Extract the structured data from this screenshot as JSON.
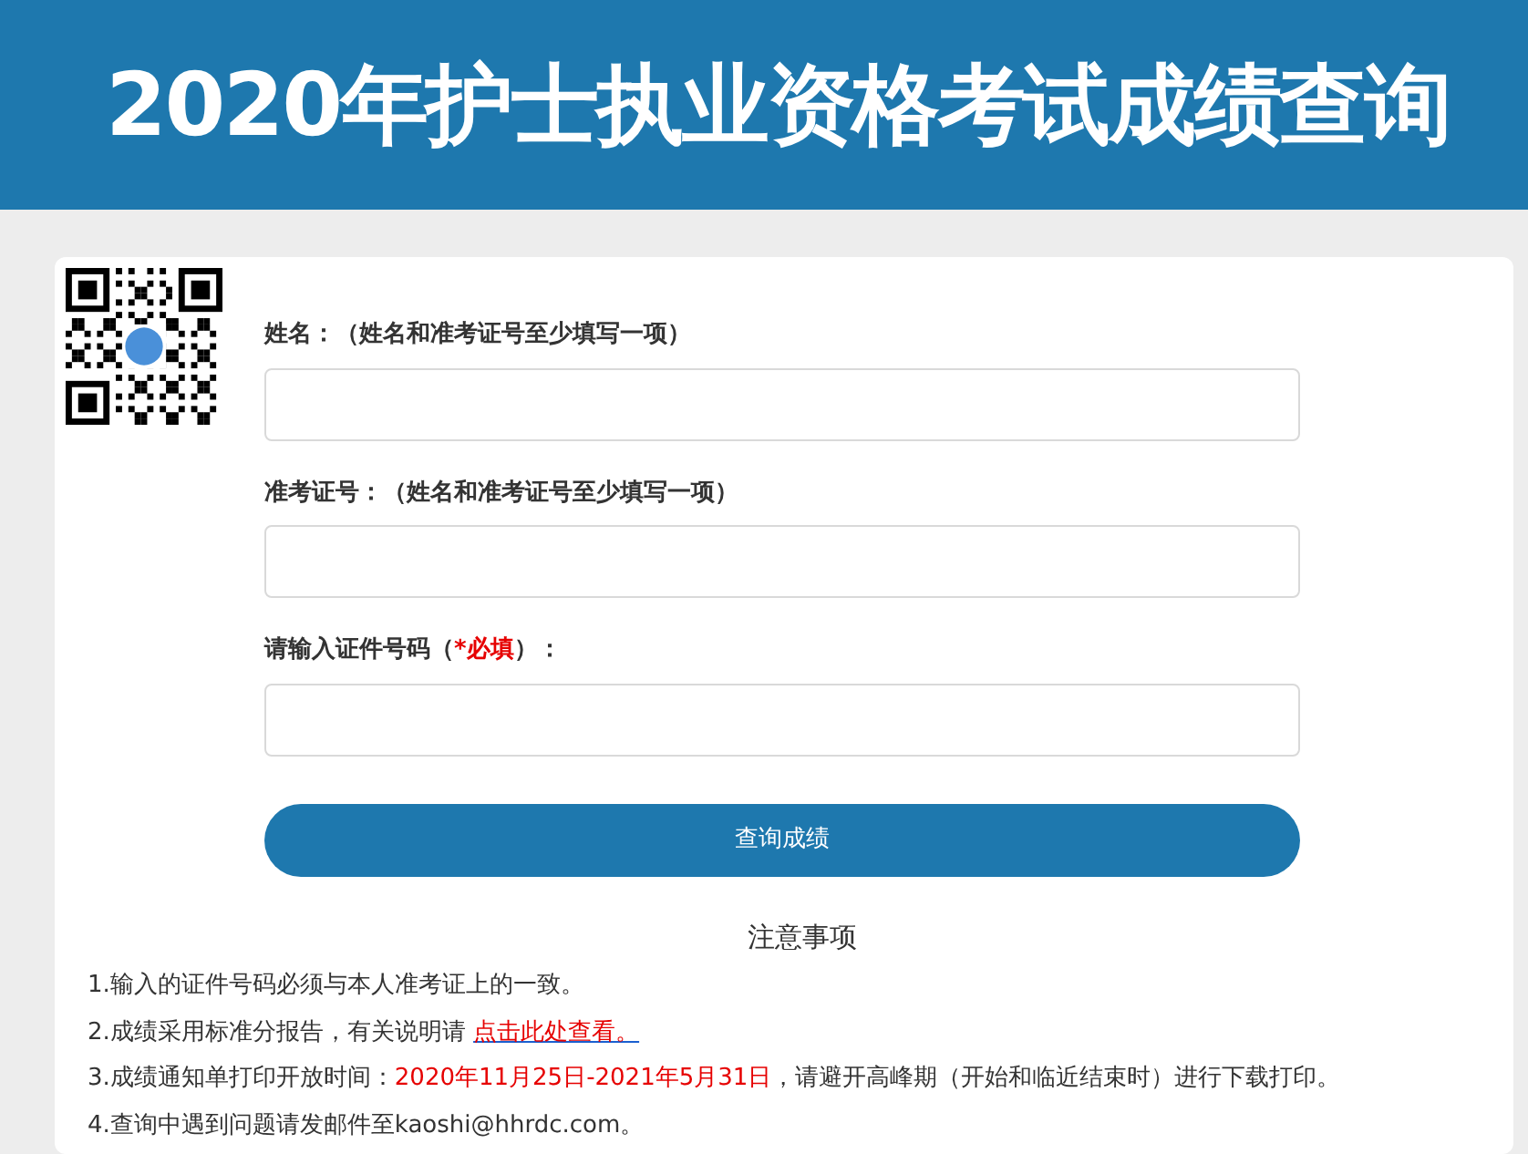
{
  "header": {
    "title": "2020年护士执业资格考试成绩查询"
  },
  "form": {
    "fields": [
      {
        "label": [
          {
            "kind": "plain",
            "text": "姓名：（姓名和准考证号至少填写一项）"
          }
        ]
      },
      {
        "label": [
          {
            "kind": "plain",
            "text": "准考证号：（姓名和准考证号至少填写一项）"
          }
        ]
      },
      {
        "label": [
          {
            "kind": "plain",
            "text": "请输入证件号码（"
          },
          {
            "kind": "required",
            "text": "*必填"
          },
          {
            "kind": "plain",
            "text": "）："
          }
        ]
      }
    ],
    "submit": "查询成绩"
  },
  "notes": {
    "title": "注意事项",
    "items": [
      [
        {
          "kind": "plain",
          "text": "1.输入的证件号码必须与本人准考证上的一致。"
        }
      ],
      [
        {
          "kind": "plain",
          "text": "2.成绩采用标准分报告，有关说明请 "
        },
        {
          "kind": "link",
          "text": "点击此处查看。"
        }
      ],
      [
        {
          "kind": "plain",
          "text": "3.成绩通知单打印开放时间："
        },
        {
          "kind": "highlight",
          "text": "2020年11月25日-2021年5月31日"
        },
        {
          "kind": "plain",
          "text": "，请避开高峰期（开始和临近结束时）进行下载打印。"
        }
      ],
      [
        {
          "kind": "plain",
          "text": "4.查询中遇到问题请发邮件至kaoshi@hhrdc.com。"
        }
      ]
    ]
  }
}
